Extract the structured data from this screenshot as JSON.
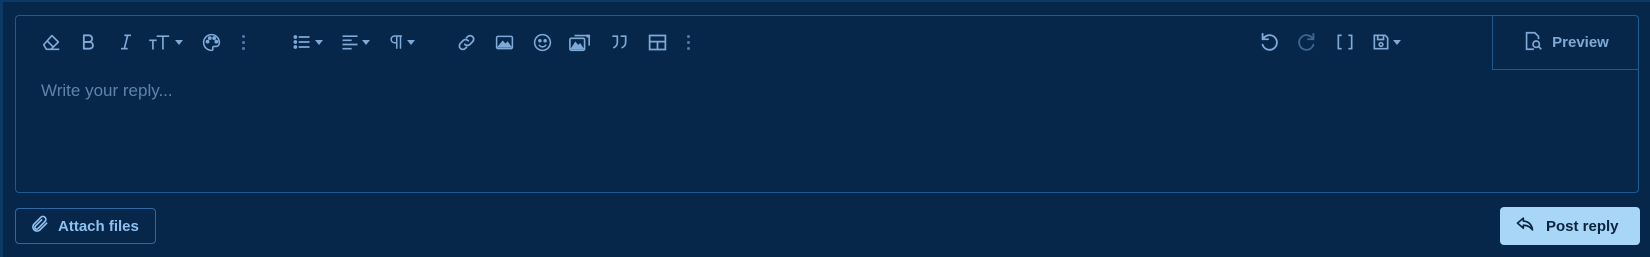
{
  "editor": {
    "placeholder": "Write your reply...",
    "toolbar": {
      "preview_label": "Preview"
    }
  },
  "actions": {
    "attach_label": "Attach files",
    "post_label": "Post reply"
  },
  "icons": {
    "clear-format": "eraser-icon",
    "bold": "bold-icon",
    "italic": "italic-icon",
    "font-size": "text-size-icon",
    "color": "palette-icon",
    "list": "list-icon",
    "align": "align-left-icon",
    "paragraph": "paragraph-icon",
    "link": "link-icon",
    "image": "image-icon",
    "smilie": "smile-icon",
    "media": "media-icon",
    "quote": "quote-icon",
    "table": "table-icon",
    "undo": "undo-icon",
    "redo": "redo-icon",
    "bbcode": "bbcode-brackets-icon",
    "drafts": "save-icon",
    "preview": "preview-search-icon",
    "attach": "paperclip-icon",
    "reply": "reply-icon"
  },
  "colors": {
    "background": "#06264a",
    "border": "#1e5a91",
    "icon": "#7fa9d6",
    "accent_button": "#a8d6f7"
  }
}
